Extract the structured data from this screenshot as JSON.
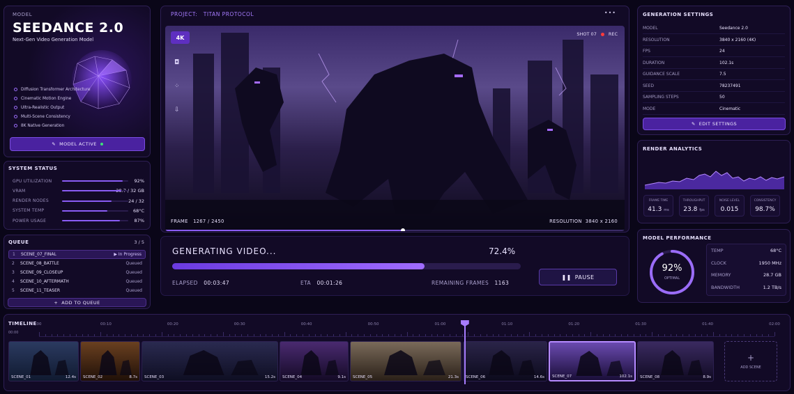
{
  "model": {
    "eyebrow": "MODEL",
    "name": "SEEDANCE 2.0",
    "tagline": "Next-Gen Video Generation Model",
    "features": [
      "Diffusion Transformer Architecture",
      "Cinematic Motion Engine",
      "Ultra-Realistic Output",
      "Multi-Scene Consistency",
      "8K Native Generation"
    ],
    "button": "MODEL ACTIVE"
  },
  "system_status": {
    "title": "SYSTEM STATUS",
    "rows": [
      {
        "label": "GPU UTILIZATION",
        "value": "92%",
        "fill": 0.92
      },
      {
        "label": "VRAM",
        "value": "28.7 / 32 GB",
        "fill": 0.897
      },
      {
        "label": "RENDER NODES",
        "value": "24 / 32",
        "fill": 0.75
      },
      {
        "label": "SYSTEM TEMP",
        "value": "68°C",
        "fill": 0.68
      },
      {
        "label": "POWER USAGE",
        "value": "87%",
        "fill": 0.87
      }
    ]
  },
  "queue": {
    "title": "QUEUE",
    "count": "3 / 5",
    "items": [
      {
        "num": "1",
        "name": "SCENE_07_FINAL",
        "status": "In Progress"
      },
      {
        "num": "2",
        "name": "SCENE_08_BATTLE",
        "status": "Queued"
      },
      {
        "num": "3",
        "name": "SCENE_09_CLOSEUP",
        "status": "Queued"
      },
      {
        "num": "4",
        "name": "SCENE_10_AFTERMATH",
        "status": "Queued"
      },
      {
        "num": "5",
        "name": "SCENE_11_TEASER",
        "status": "Queued"
      }
    ],
    "add_button": "ADD TO QUEUE"
  },
  "project": {
    "label": "PROJECT:",
    "name": "TITAN PROTOCOL",
    "more_icon": "•••"
  },
  "viewer": {
    "badge": "4K",
    "shot": "SHOT 07",
    "rec": "REC",
    "frame_label": "FRAME",
    "frame_value": "1267 / 2450",
    "resolution_label": "RESOLUTION",
    "resolution_value": "3840 x 2160",
    "scrub_progress": 0.517
  },
  "generation": {
    "title": "GENERATING VIDEO...",
    "percent": "72.4%",
    "progress": 0.724,
    "elapsed_label": "ELAPSED",
    "elapsed_value": "00:03:47",
    "eta_label": "ETA",
    "eta_value": "00:01:26",
    "remaining_label": "REMAINING FRAMES",
    "remaining_value": "1163",
    "pause_button": "PAUSE"
  },
  "settings": {
    "title": "GENERATION SETTINGS",
    "rows": [
      {
        "k": "MODEL",
        "v": "Seedance 2.0"
      },
      {
        "k": "RESOLUTION",
        "v": "3840 x 2160 (4K)"
      },
      {
        "k": "FPS",
        "v": "24"
      },
      {
        "k": "DURATION",
        "v": "102.1s"
      },
      {
        "k": "GUIDANCE SCALE",
        "v": "7.5"
      },
      {
        "k": "SEED",
        "v": "78237491"
      },
      {
        "k": "SAMPLING STEPS",
        "v": "50"
      },
      {
        "k": "MODE",
        "v": "Cinematic"
      }
    ],
    "edit_button": "EDIT SETTINGS"
  },
  "analytics": {
    "title": "RENDER ANALYTICS",
    "stats": [
      {
        "label": "FRAME TIME",
        "value": "41.3",
        "unit": "ms"
      },
      {
        "label": "THROUGHPUT",
        "value": "23.8",
        "unit": "fps"
      },
      {
        "label": "NOISE LEVEL",
        "value": "0.015",
        "unit": ""
      },
      {
        "label": "CONSISTENCY",
        "value": "98.7%",
        "unit": ""
      }
    ]
  },
  "performance": {
    "title": "MODEL PERFORMANCE",
    "gauge_value": "92%",
    "gauge_label": "OPTIMAL",
    "gauge_fill": 0.92,
    "rows": [
      {
        "k": "TEMP",
        "v": "68°C"
      },
      {
        "k": "CLOCK",
        "v": "1950 MHz"
      },
      {
        "k": "MEMORY",
        "v": "28.7 GB"
      },
      {
        "k": "BANDWIDTH",
        "v": "1.2 TB/s"
      }
    ]
  },
  "timeline": {
    "title": "TIMELINE",
    "start": "00:00",
    "ticks": [
      "00",
      "00:10",
      "00:20",
      "00:30",
      "00:40",
      "00:50",
      "01:00",
      "01:10",
      "01:20",
      "01:30",
      "01:40",
      "02:00"
    ],
    "playhead": 0.578,
    "clips": [
      {
        "name": "SCENE_01",
        "dur": "12.4s"
      },
      {
        "name": "SCENE_02",
        "dur": "8.7s"
      },
      {
        "name": "SCENE_03",
        "dur": "15.2s"
      },
      {
        "name": "SCENE_04",
        "dur": "9.1s"
      },
      {
        "name": "SCENE_05",
        "dur": "21.3s"
      },
      {
        "name": "SCENE_06",
        "dur": "14.6s"
      },
      {
        "name": "SCENE_07",
        "dur": "102.1s"
      },
      {
        "name": "SCENE_08",
        "dur": "8.9s"
      }
    ],
    "add_scene": "ADD SCENE"
  },
  "colors": {
    "accent": "#8a5cf5",
    "panel": "#120a26",
    "rec": "#ff3b3b",
    "active_dot": "#3de07a"
  }
}
